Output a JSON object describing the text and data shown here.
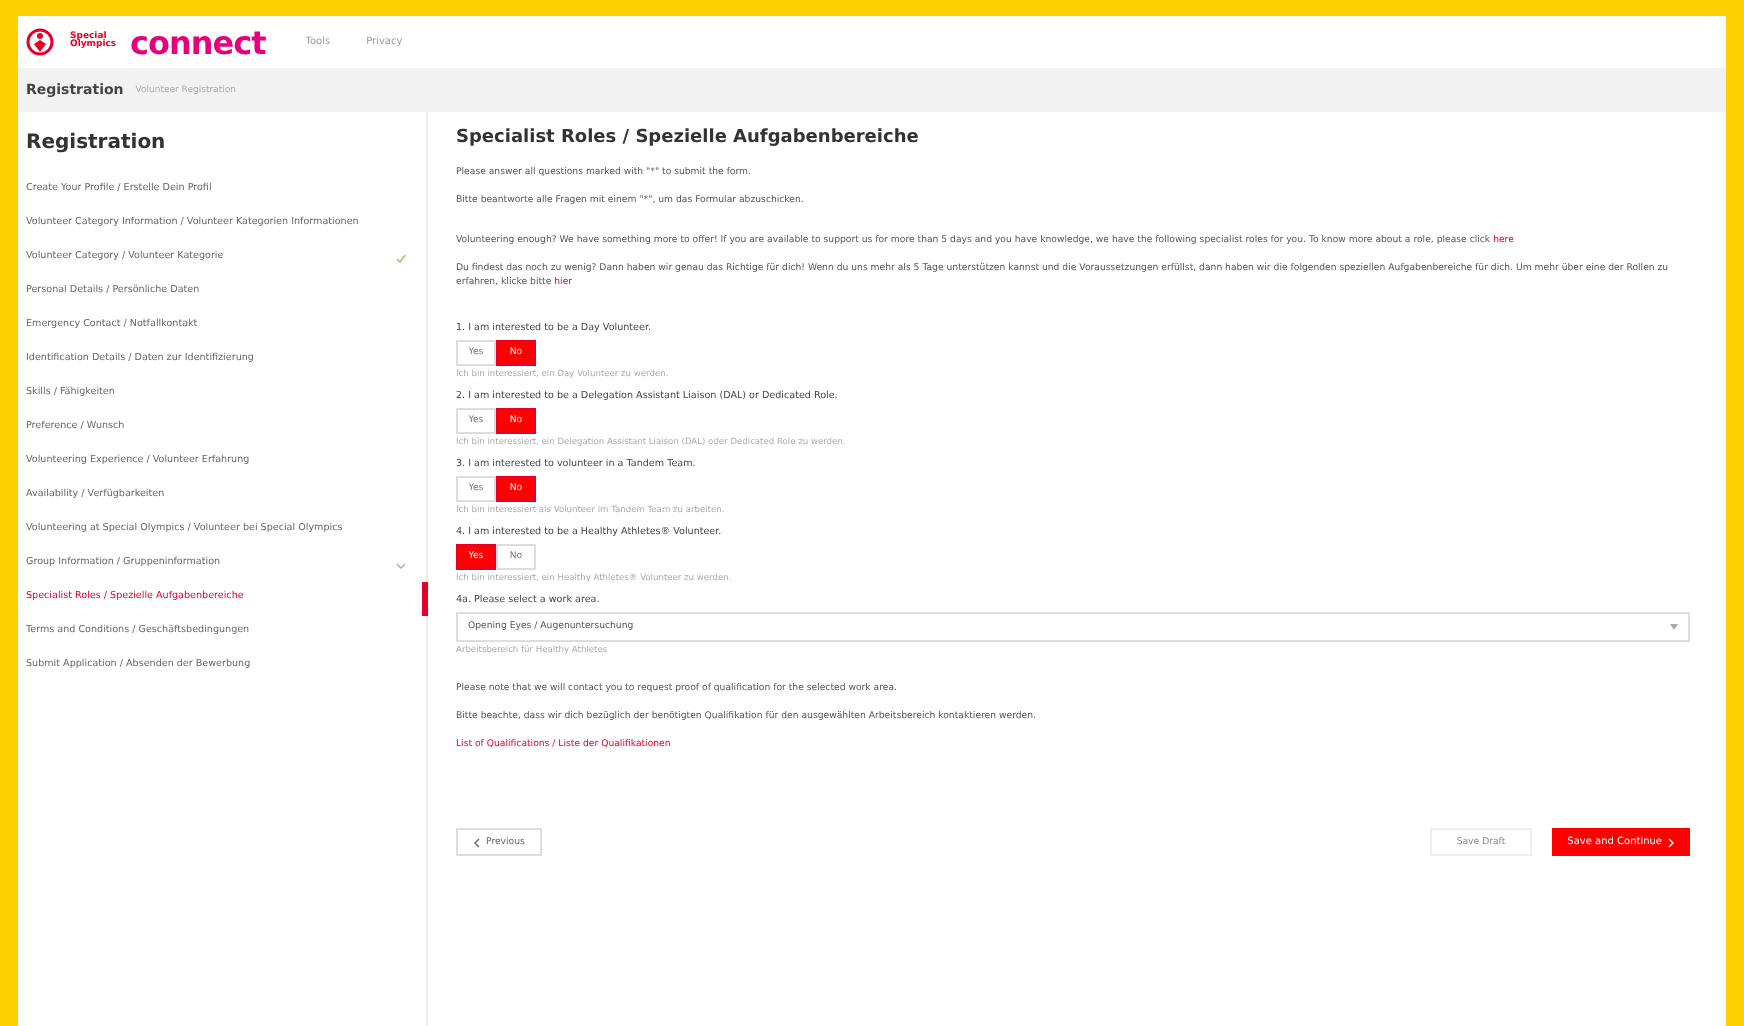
{
  "header": {
    "org": "Special Olympics",
    "app": "connect",
    "nav": [
      "Tools",
      "Privacy"
    ]
  },
  "breadcrumb": {
    "title": "Registration",
    "sub": "Volunteer Registration"
  },
  "sidebar": {
    "title": "Registration",
    "items": [
      {
        "label": "Create Your Profile / Erstelle Dein Profil",
        "selected": false
      },
      {
        "label": "Volunteer Category Information / Volunteer Kategorien Informationen",
        "selected": false
      },
      {
        "label": "Volunteer Category / Volunteer Kategorie",
        "selected": false,
        "kind": "done"
      },
      {
        "label": "Personal Details / Persönliche Daten",
        "selected": false
      },
      {
        "label": "Emergency Contact / Notfallkontakt",
        "selected": false
      },
      {
        "label": "Identification Details / Daten zur Identifizierung",
        "selected": false
      },
      {
        "label": "Skills / Fähigkeiten",
        "selected": false
      },
      {
        "label": "Preference / Wunsch",
        "selected": false
      },
      {
        "label": "Volunteering Experience / Volunteer Erfahrung",
        "selected": false
      },
      {
        "label": "Availability / Verfügbarkeiten",
        "selected": false
      },
      {
        "label": "Volunteering at Special Olympics / Volunteer bei Special Olympics",
        "selected": false
      },
      {
        "label": "Group Information / Gruppeninformation",
        "selected": false,
        "kind": "group"
      },
      {
        "label": "Specialist Roles / Spezielle Aufgabenbereiche",
        "selected": true
      },
      {
        "label": "Terms and Conditions / Geschäftsbedingungen",
        "selected": false
      },
      {
        "label": "Submit Application / Absenden der Bewerbung",
        "selected": false
      }
    ]
  },
  "main": {
    "title": "Specialist Roles / Spezielle Aufgabenbereiche",
    "intro": [
      "Please answer all questions marked with \"*\" to submit the form.",
      "Bitte beantworte alle Fragen mit einem \"*\", um das Formular abzuschicken."
    ],
    "paragraphs": [
      {
        "text": "Volunteering enough? We have something more to offer! If you are available to support us for more than 5 days and you have knowledge, we have the following specialist roles for you. To know more about a role, please click",
        "link": "here"
      },
      {
        "text": "Du findest das noch zu wenig? Dann haben wir genau das Richtige für dich! Wenn du uns mehr als 5 Tage unterstützen kannst und die Voraussetzungen erfüllst, dann haben wir die folgenden speziellen Aufgabenbereiche für dich. Um mehr über eine der Rollen zu erfahren, klicke bitte",
        "link": "hier"
      }
    ],
    "questions": [
      {
        "label": "1. I am interested to be a Day Volunteer.",
        "options": [
          {
            "label": "Yes",
            "selected": false
          },
          {
            "label": "No",
            "selected": true
          }
        ],
        "hint": "Ich bin interessiert, ein Day Volunteer zu werden."
      },
      {
        "label": "2. I am interested to be a Delegation Assistant Liaison (DAL) or Dedicated Role.",
        "options": [
          {
            "label": "Yes",
            "selected": false
          },
          {
            "label": "No",
            "selected": true
          }
        ],
        "hint": "Ich bin interessiert, ein Delegation Assistant Liaison (DAL) oder Dedicated Role zu werden."
      },
      {
        "label": "3. I am interested to volunteer in a Tandem Team.",
        "options": [
          {
            "label": "Yes",
            "selected": false
          },
          {
            "label": "No",
            "selected": true
          }
        ],
        "hint": "Ich bin interessiert als Volunteer im Tandem Team zu arbeiten."
      },
      {
        "label": "4. I am interested to be a Healthy Athletes® Volunteer.",
        "options": [
          {
            "label": "Yes",
            "selected": true
          },
          {
            "label": "No",
            "selected": false
          }
        ],
        "hint": "Ich bin interessiert, ein Healthy Athletes® Volunteer zu werden."
      }
    ],
    "select": {
      "label": "4a. Please select a work area.",
      "value": "Opening Eyes / Augenuntersuchung",
      "hint": "Arbeitsbereich für Healthy Athletes"
    },
    "notes": [
      "Please note that we will contact you to request proof of qualification for the selected work area.",
      "Bitte beachte, dass wir dich bezüglich der benötigten Qualifikation für den ausgewählten Arbeitsbereich kontaktieren werden."
    ],
    "qual_link": "List of Qualifications / Liste der Qualifikationen",
    "buttons": {
      "previous": "Previous",
      "draft": "Save Draft",
      "next": "Save and Continue"
    }
  }
}
